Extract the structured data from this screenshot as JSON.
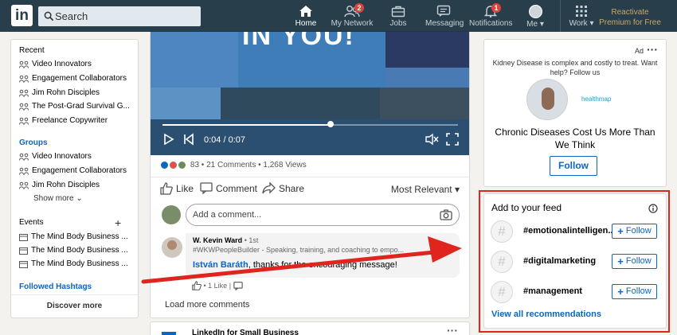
{
  "nav": {
    "logo": "in",
    "search_placeholder": "Search",
    "items": [
      {
        "label": "Home",
        "icon": "home-icon"
      },
      {
        "label": "My Network",
        "icon": "network-icon",
        "badge": "2"
      },
      {
        "label": "Jobs",
        "icon": "briefcase-icon"
      },
      {
        "label": "Messaging",
        "icon": "messaging-icon"
      },
      {
        "label": "Notifications",
        "icon": "bell-icon",
        "badge": "1"
      },
      {
        "label": "Me",
        "icon": "avatar"
      },
      {
        "label": "Work",
        "icon": "grid-icon"
      }
    ],
    "reactivate": "Reactivate Premium for Free"
  },
  "sidebar": {
    "recent_header": "Recent",
    "recent": [
      "Video Innovators",
      "Engagement Collaborators",
      "Jim Rohn Disciples",
      "The Post-Grad Survival G...",
      "Freelance Copywriter"
    ],
    "groups_header": "Groups",
    "groups": [
      "Video Innovators",
      "Engagement Collaborators",
      "Jim Rohn Disciples"
    ],
    "show_more": "Show more",
    "events_header": "Events",
    "events": [
      "The Mind Body Business ...",
      "The Mind Body Business ...",
      "The Mind Body Business ..."
    ],
    "hashtags_header": "Followed Hashtags",
    "discover": "Discover more"
  },
  "post": {
    "video_overlay_text": "IN YOU!",
    "video_time": "0:04 / 0:07",
    "progress": 0.57,
    "reactions_count": "83",
    "comments": "21 Comments",
    "views": "1,268 Views",
    "like": "Like",
    "comment": "Comment",
    "share": "Share",
    "sort": "Most Relevant",
    "comment_placeholder": "Add a comment...",
    "reply": {
      "author": "W. Kevin Ward",
      "degree": "• 1st",
      "headline": "#WKWPeopleBuilder - Speaking, training, and coaching to empo...",
      "mention": "István Baráth",
      "text": ", thanks for the encouraging message!",
      "likes": "1 Like"
    },
    "load_more": "Load more comments"
  },
  "next_post": {
    "title": "LinkedIn for Small Business"
  },
  "ad": {
    "label": "Ad",
    "text": "Kidney Disease is complex and costly to treat. Want help? Follow us",
    "brand": "healthmap",
    "headline": "Chronic Diseases Cost Us More Than We Think",
    "button": "Follow"
  },
  "feed": {
    "title": "Add to your feed",
    "items": [
      {
        "tag": "#emotionalintelligen...",
        "button": "Follow"
      },
      {
        "tag": "#digitalmarketing",
        "button": "Follow"
      },
      {
        "tag": "#management",
        "button": "Follow"
      }
    ],
    "view_all": "View all recommendations"
  },
  "colors": {
    "nav_bg": "#283e4a",
    "link_blue": "#0a66c2",
    "annotation_red": "#e0241e",
    "badge_red": "#e0413a"
  }
}
